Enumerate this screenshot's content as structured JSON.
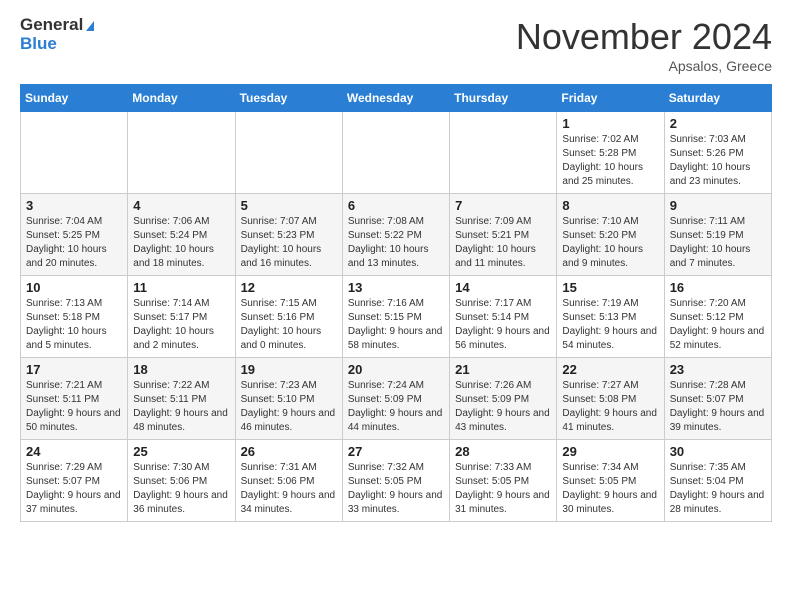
{
  "header": {
    "logo_general": "General",
    "logo_blue": "Blue",
    "month_title": "November 2024",
    "subtitle": "Apsalos, Greece"
  },
  "weekdays": [
    "Sunday",
    "Monday",
    "Tuesday",
    "Wednesday",
    "Thursday",
    "Friday",
    "Saturday"
  ],
  "weeks": [
    [
      {
        "day": "",
        "info": ""
      },
      {
        "day": "",
        "info": ""
      },
      {
        "day": "",
        "info": ""
      },
      {
        "day": "",
        "info": ""
      },
      {
        "day": "",
        "info": ""
      },
      {
        "day": "1",
        "info": "Sunrise: 7:02 AM\nSunset: 5:28 PM\nDaylight: 10 hours and 25 minutes."
      },
      {
        "day": "2",
        "info": "Sunrise: 7:03 AM\nSunset: 5:26 PM\nDaylight: 10 hours and 23 minutes."
      }
    ],
    [
      {
        "day": "3",
        "info": "Sunrise: 7:04 AM\nSunset: 5:25 PM\nDaylight: 10 hours and 20 minutes."
      },
      {
        "day": "4",
        "info": "Sunrise: 7:06 AM\nSunset: 5:24 PM\nDaylight: 10 hours and 18 minutes."
      },
      {
        "day": "5",
        "info": "Sunrise: 7:07 AM\nSunset: 5:23 PM\nDaylight: 10 hours and 16 minutes."
      },
      {
        "day": "6",
        "info": "Sunrise: 7:08 AM\nSunset: 5:22 PM\nDaylight: 10 hours and 13 minutes."
      },
      {
        "day": "7",
        "info": "Sunrise: 7:09 AM\nSunset: 5:21 PM\nDaylight: 10 hours and 11 minutes."
      },
      {
        "day": "8",
        "info": "Sunrise: 7:10 AM\nSunset: 5:20 PM\nDaylight: 10 hours and 9 minutes."
      },
      {
        "day": "9",
        "info": "Sunrise: 7:11 AM\nSunset: 5:19 PM\nDaylight: 10 hours and 7 minutes."
      }
    ],
    [
      {
        "day": "10",
        "info": "Sunrise: 7:13 AM\nSunset: 5:18 PM\nDaylight: 10 hours and 5 minutes."
      },
      {
        "day": "11",
        "info": "Sunrise: 7:14 AM\nSunset: 5:17 PM\nDaylight: 10 hours and 2 minutes."
      },
      {
        "day": "12",
        "info": "Sunrise: 7:15 AM\nSunset: 5:16 PM\nDaylight: 10 hours and 0 minutes."
      },
      {
        "day": "13",
        "info": "Sunrise: 7:16 AM\nSunset: 5:15 PM\nDaylight: 9 hours and 58 minutes."
      },
      {
        "day": "14",
        "info": "Sunrise: 7:17 AM\nSunset: 5:14 PM\nDaylight: 9 hours and 56 minutes."
      },
      {
        "day": "15",
        "info": "Sunrise: 7:19 AM\nSunset: 5:13 PM\nDaylight: 9 hours and 54 minutes."
      },
      {
        "day": "16",
        "info": "Sunrise: 7:20 AM\nSunset: 5:12 PM\nDaylight: 9 hours and 52 minutes."
      }
    ],
    [
      {
        "day": "17",
        "info": "Sunrise: 7:21 AM\nSunset: 5:11 PM\nDaylight: 9 hours and 50 minutes."
      },
      {
        "day": "18",
        "info": "Sunrise: 7:22 AM\nSunset: 5:11 PM\nDaylight: 9 hours and 48 minutes."
      },
      {
        "day": "19",
        "info": "Sunrise: 7:23 AM\nSunset: 5:10 PM\nDaylight: 9 hours and 46 minutes."
      },
      {
        "day": "20",
        "info": "Sunrise: 7:24 AM\nSunset: 5:09 PM\nDaylight: 9 hours and 44 minutes."
      },
      {
        "day": "21",
        "info": "Sunrise: 7:26 AM\nSunset: 5:09 PM\nDaylight: 9 hours and 43 minutes."
      },
      {
        "day": "22",
        "info": "Sunrise: 7:27 AM\nSunset: 5:08 PM\nDaylight: 9 hours and 41 minutes."
      },
      {
        "day": "23",
        "info": "Sunrise: 7:28 AM\nSunset: 5:07 PM\nDaylight: 9 hours and 39 minutes."
      }
    ],
    [
      {
        "day": "24",
        "info": "Sunrise: 7:29 AM\nSunset: 5:07 PM\nDaylight: 9 hours and 37 minutes."
      },
      {
        "day": "25",
        "info": "Sunrise: 7:30 AM\nSunset: 5:06 PM\nDaylight: 9 hours and 36 minutes."
      },
      {
        "day": "26",
        "info": "Sunrise: 7:31 AM\nSunset: 5:06 PM\nDaylight: 9 hours and 34 minutes."
      },
      {
        "day": "27",
        "info": "Sunrise: 7:32 AM\nSunset: 5:05 PM\nDaylight: 9 hours and 33 minutes."
      },
      {
        "day": "28",
        "info": "Sunrise: 7:33 AM\nSunset: 5:05 PM\nDaylight: 9 hours and 31 minutes."
      },
      {
        "day": "29",
        "info": "Sunrise: 7:34 AM\nSunset: 5:05 PM\nDaylight: 9 hours and 30 minutes."
      },
      {
        "day": "30",
        "info": "Sunrise: 7:35 AM\nSunset: 5:04 PM\nDaylight: 9 hours and 28 minutes."
      }
    ]
  ]
}
